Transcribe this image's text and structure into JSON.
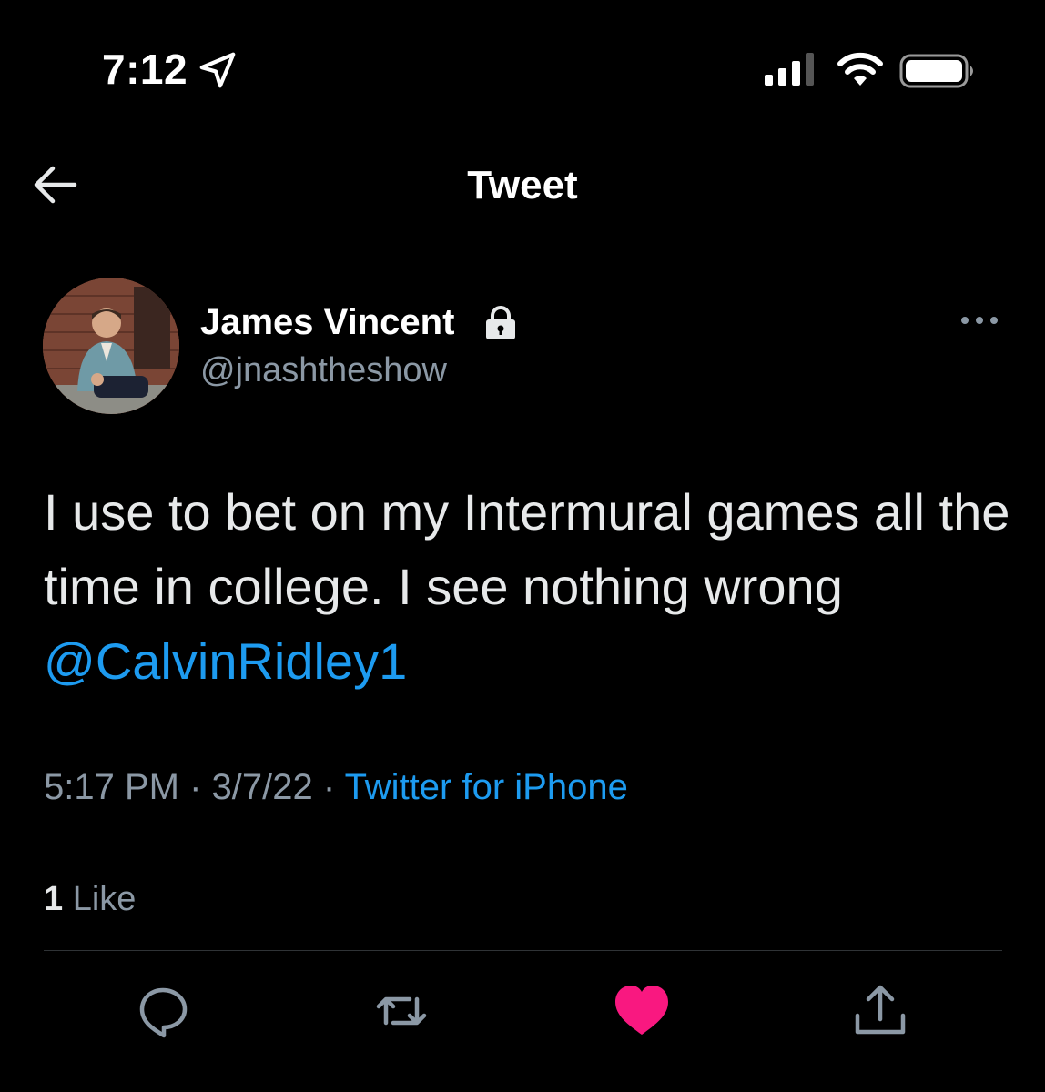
{
  "status_bar": {
    "time": "7:12",
    "icons": [
      "location-arrow-icon",
      "cellular-signal-icon",
      "wifi-icon",
      "battery-icon"
    ]
  },
  "nav": {
    "title": "Tweet",
    "back_icon": "back-arrow-icon"
  },
  "tweet": {
    "author_name": "James Vincent",
    "author_handle": "@jnashtheshow",
    "protected_icon": "lock-icon",
    "more_icon": "more-options-icon",
    "text_main": "I use to bet on my Intermural games all the time in college. I see nothing wrong ",
    "mention": "@CalvinRidley1",
    "time": "5:17 PM",
    "separator": " · ",
    "date": "3/7/22",
    "source": "Twitter for iPhone",
    "like_count": "1",
    "like_label": " Like"
  },
  "actions": [
    {
      "name": "reply-icon"
    },
    {
      "name": "retweet-icon"
    },
    {
      "name": "like-icon",
      "active": true
    },
    {
      "name": "share-icon"
    }
  ],
  "colors": {
    "background": "#000000",
    "text": "#e7e9ea",
    "secondary_text": "#8b98a5",
    "link": "#1d9bf0",
    "like_active": "#f91880",
    "divider": "#2f3336"
  }
}
